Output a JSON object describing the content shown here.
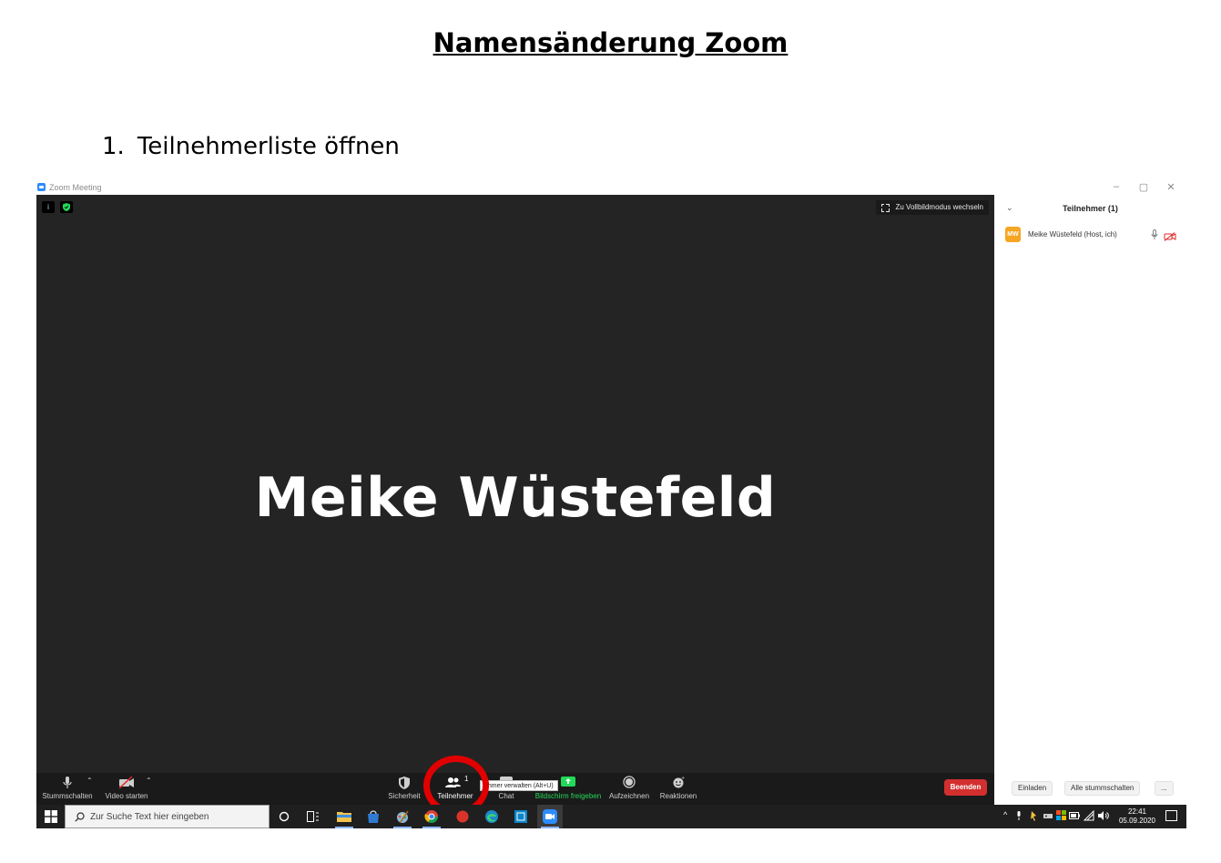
{
  "document": {
    "title": "Namensänderung Zoom",
    "step_number": "1.",
    "step_text": "Teilnehmerliste öffnen"
  },
  "window": {
    "title": "Zoom Meeting",
    "controls": [
      "–",
      "▢",
      "✕"
    ],
    "fullscreen_label": "Zu Vollbildmodus wechseln",
    "info_icon": "i"
  },
  "video": {
    "participant_name": "Meike Wüstefeld"
  },
  "toolbar": {
    "mute_label": "Stummschalten",
    "video_label": "Video starten",
    "security_label": "Sicherheit",
    "participants_label": "Teilnehmer",
    "participants_count": "1",
    "chat_label": "Chat",
    "share_label": "Bildschirm freigeben",
    "record_label": "Aufzeichnen",
    "reactions_label": "Reaktionen",
    "end_label": "Beenden",
    "tooltip": "Teilnehmer verwalten (Alt+U)",
    "tooltip_visible": "ehmer verwalten (Alt+U)"
  },
  "sidebar": {
    "title": "Teilnehmer (1)",
    "participants": [
      {
        "initials": "MW",
        "name": "Meike Wüstefeld (Host, ich)",
        "avatar_color": "#f5a623"
      }
    ],
    "invite_label": "Einladen",
    "mute_all_label": "Alle stummschalten",
    "more_label": "..."
  },
  "taskbar": {
    "search_placeholder": "Zur Suche Text hier eingeben",
    "time": "22:41",
    "date": "05.09.2020"
  },
  "colors": {
    "video_bg": "#242424",
    "toolbar_bg": "#1a1a1a",
    "end_button": "#d32f2f",
    "share_green": "#23d959",
    "highlight": "#e10000",
    "zoom_blue": "#2d8cff"
  }
}
